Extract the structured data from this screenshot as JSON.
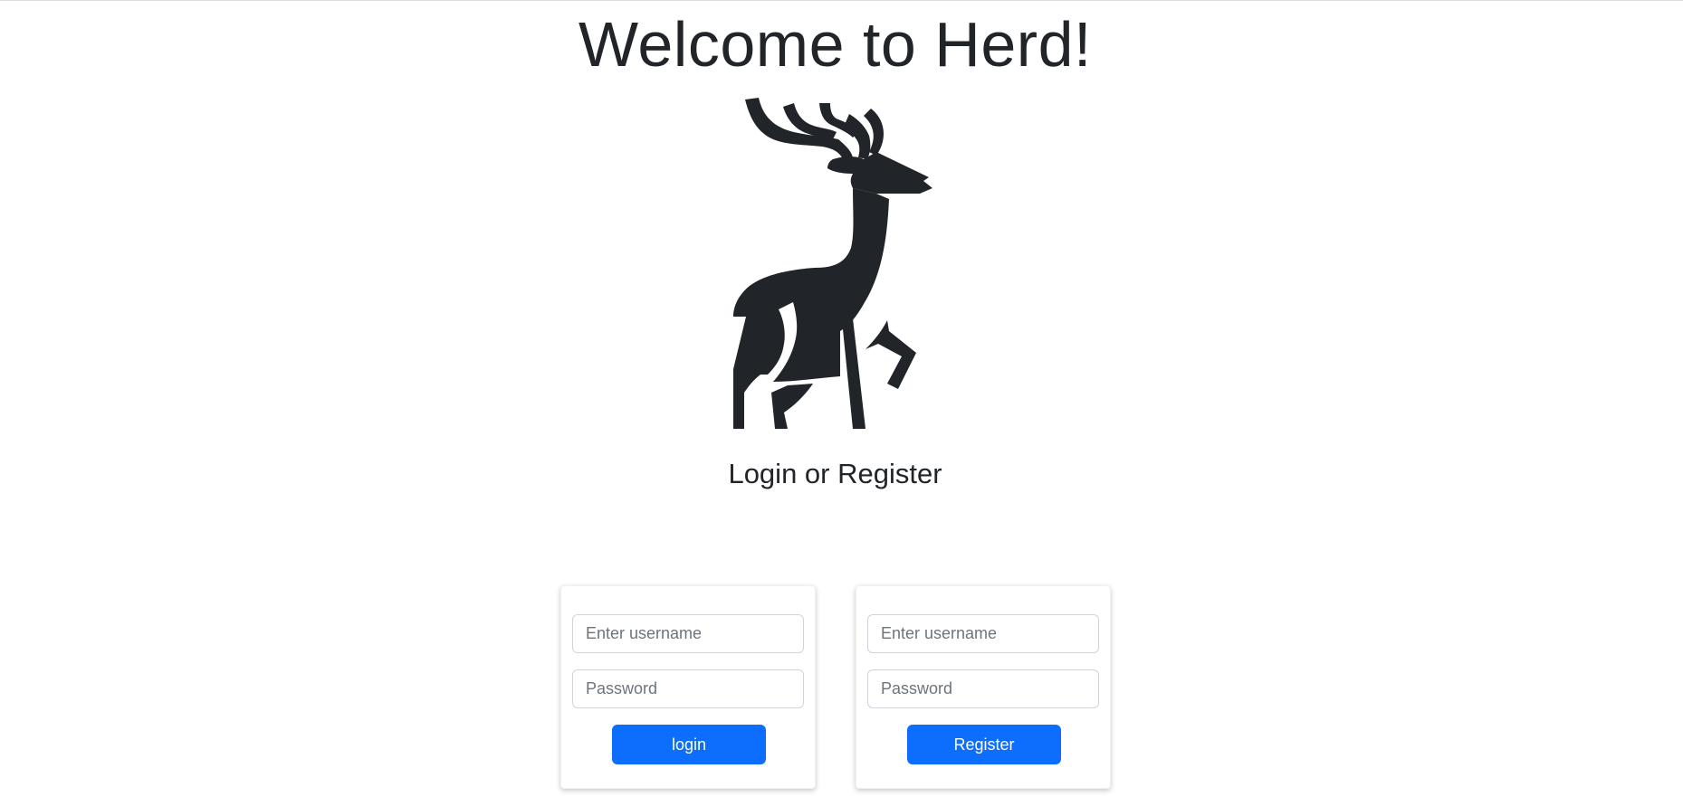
{
  "page": {
    "title": "Welcome to Herd!",
    "subtitle": "Login or Register"
  },
  "logo": {
    "icon": "deer-icon",
    "color": "#212529"
  },
  "login_form": {
    "username_placeholder": "Enter username",
    "password_placeholder": "Password",
    "button_label": "login"
  },
  "register_form": {
    "username_placeholder": "Enter username",
    "password_placeholder": "Password",
    "button_label": "Register"
  },
  "colors": {
    "primary_button": "#0d6efd",
    "text": "#212529",
    "placeholder": "#6c757d"
  }
}
